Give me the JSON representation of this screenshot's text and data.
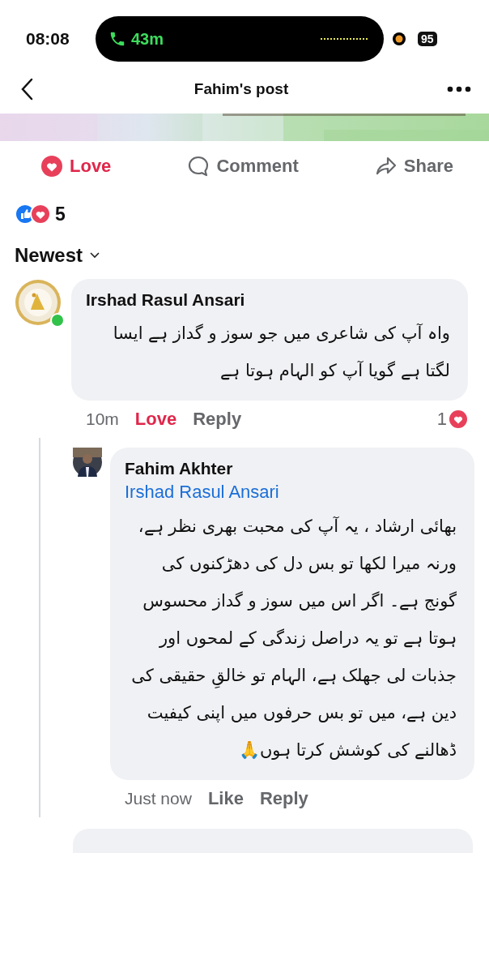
{
  "status_bar": {
    "time": "08:08",
    "call_duration": "43m",
    "battery": "95"
  },
  "header": {
    "title": "Fahim's post"
  },
  "actions": {
    "love": {
      "label": "Love",
      "active": true
    },
    "comment": {
      "label": "Comment",
      "active": false
    },
    "share": {
      "label": "Share",
      "active": false
    }
  },
  "reactions": {
    "count": "5"
  },
  "sort": {
    "label": "Newest"
  },
  "comments": [
    {
      "author": "Irshad Rasul Ansari",
      "online": true,
      "text": "واہ آپ کی شاعری میں جو سوز و گداز ہے ایسا لگتا ہے گویا آپ کو الہام ہوتا ہے",
      "time": "10m",
      "reaction": {
        "label": "Love",
        "active": true
      },
      "reply": "Reply",
      "reaction_count": "1",
      "replies": [
        {
          "author": "Fahim Akhter",
          "mention": "Irshad Rasul Ansari",
          "text": "بھائی ارشاد ، یہ آپ کی محبت بھری نظر ہے، ورنہ میرا لکھا تو بس دل کی دھڑکنوں کی گونج ہے۔ اگر اس میں سوز و گداز محسوس ہوتا ہے تو یہ دراصل زندگی کے لمحوں اور جذبات لی جھلک ہے، الہام تو خالقِ حقیقی کی دین ہے، میں تو بس حرفوں میں اپنی کیفیت ڈھالنے کی کوشش کرتا ہوں🙏",
          "time": "Just now",
          "reaction": {
            "label": "Like",
            "active": false
          },
          "reply": "Reply"
        }
      ]
    }
  ]
}
